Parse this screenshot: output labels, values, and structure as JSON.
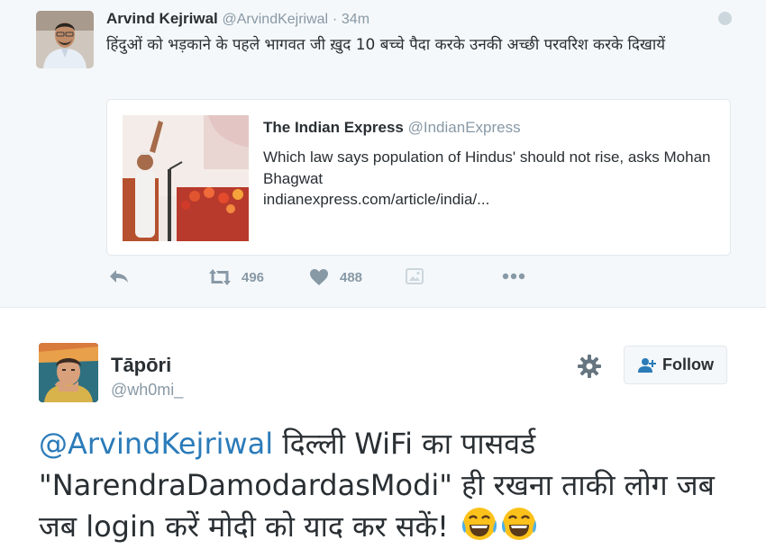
{
  "top_tweet": {
    "author_name": "Arvind Kejriwal",
    "author_handle": "@ArvindKejriwal",
    "separator": "·",
    "time": "34m",
    "text": "हिंदुओं को भड़काने के पहले भागवत जी ख़ुद 10 बच्चे पैदा करके उनकी अच्छी परवरिश करके दिखायें",
    "card": {
      "source_name": "The Indian Express",
      "source_handle": "@IndianExpress",
      "description": "Which law says population of Hindus' should not rise, asks Mohan Bhagwat",
      "url": "indianexpress.com/article/india/..."
    },
    "actions": {
      "retweet_count": "496",
      "like_count": "488"
    }
  },
  "bottom_tweet": {
    "author_name": "Tāpōri",
    "author_handle": "@wh0mi_",
    "follow_label": "Follow",
    "mention": "@ArvindKejriwal",
    "text": " दिल्ली WiFi का पासवर्ड \"NarendraDamodardasModi\" ही रखना ताकी लोग जब जब login करें मोदी को याद कर सकें!"
  },
  "colors": {
    "link": "#2b7bb9",
    "muted": "#8899a6",
    "text": "#292f33",
    "top_background": "#f5f8fa"
  },
  "icons": [
    "reply-icon",
    "retweet-icon",
    "heart-icon",
    "media-icon",
    "more-icon",
    "globe-icon",
    "gear-icon",
    "add-user-icon",
    "joy-emoji"
  ]
}
